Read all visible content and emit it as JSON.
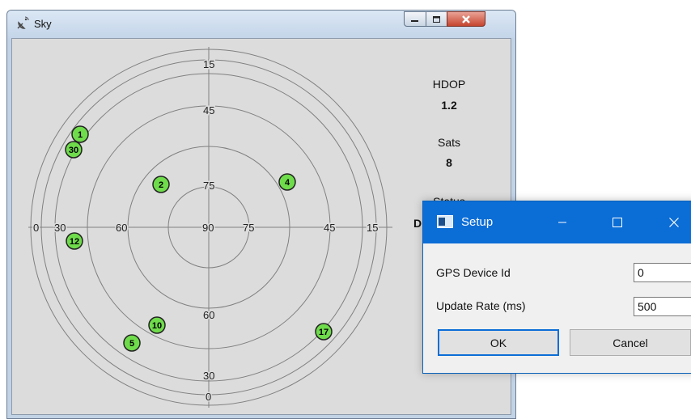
{
  "sky_window": {
    "title": "Sky",
    "app_icon": "satellite-dish-icon",
    "buttons": {
      "minimize": "minimize-icon",
      "maximize": "maximize-icon",
      "close": "close-icon"
    }
  },
  "sky_plot": {
    "elevation_rings": [
      0,
      15,
      30,
      45,
      60,
      75,
      90
    ],
    "axis_labels": {
      "north": [
        "15",
        "45",
        "75"
      ],
      "south": [
        "60",
        "30",
        "0"
      ],
      "west": [
        "0",
        "30",
        "60"
      ],
      "east": [
        "75",
        "45",
        "15"
      ],
      "center": "90"
    },
    "satellite_color": "#6fdc4b",
    "satellites": [
      {
        "id": "1"
      },
      {
        "id": "30"
      },
      {
        "id": "2"
      },
      {
        "id": "4"
      },
      {
        "id": "12"
      },
      {
        "id": "10"
      },
      {
        "id": "5"
      },
      {
        "id": "17"
      }
    ]
  },
  "stats": {
    "hdop_label": "HDOP",
    "hdop_value": "1.2",
    "sats_label": "Sats",
    "sats_value": "8",
    "status_label": "Status",
    "status_value_partial": "D"
  },
  "setup_dialog": {
    "title": "Setup",
    "accent": "#0b6dd6",
    "gps_device_id_label": "GPS Device Id",
    "gps_device_id_value": "0",
    "update_rate_label": "Update Rate (ms)",
    "update_rate_value": "500",
    "ok_label": "OK",
    "cancel_label": "Cancel"
  }
}
